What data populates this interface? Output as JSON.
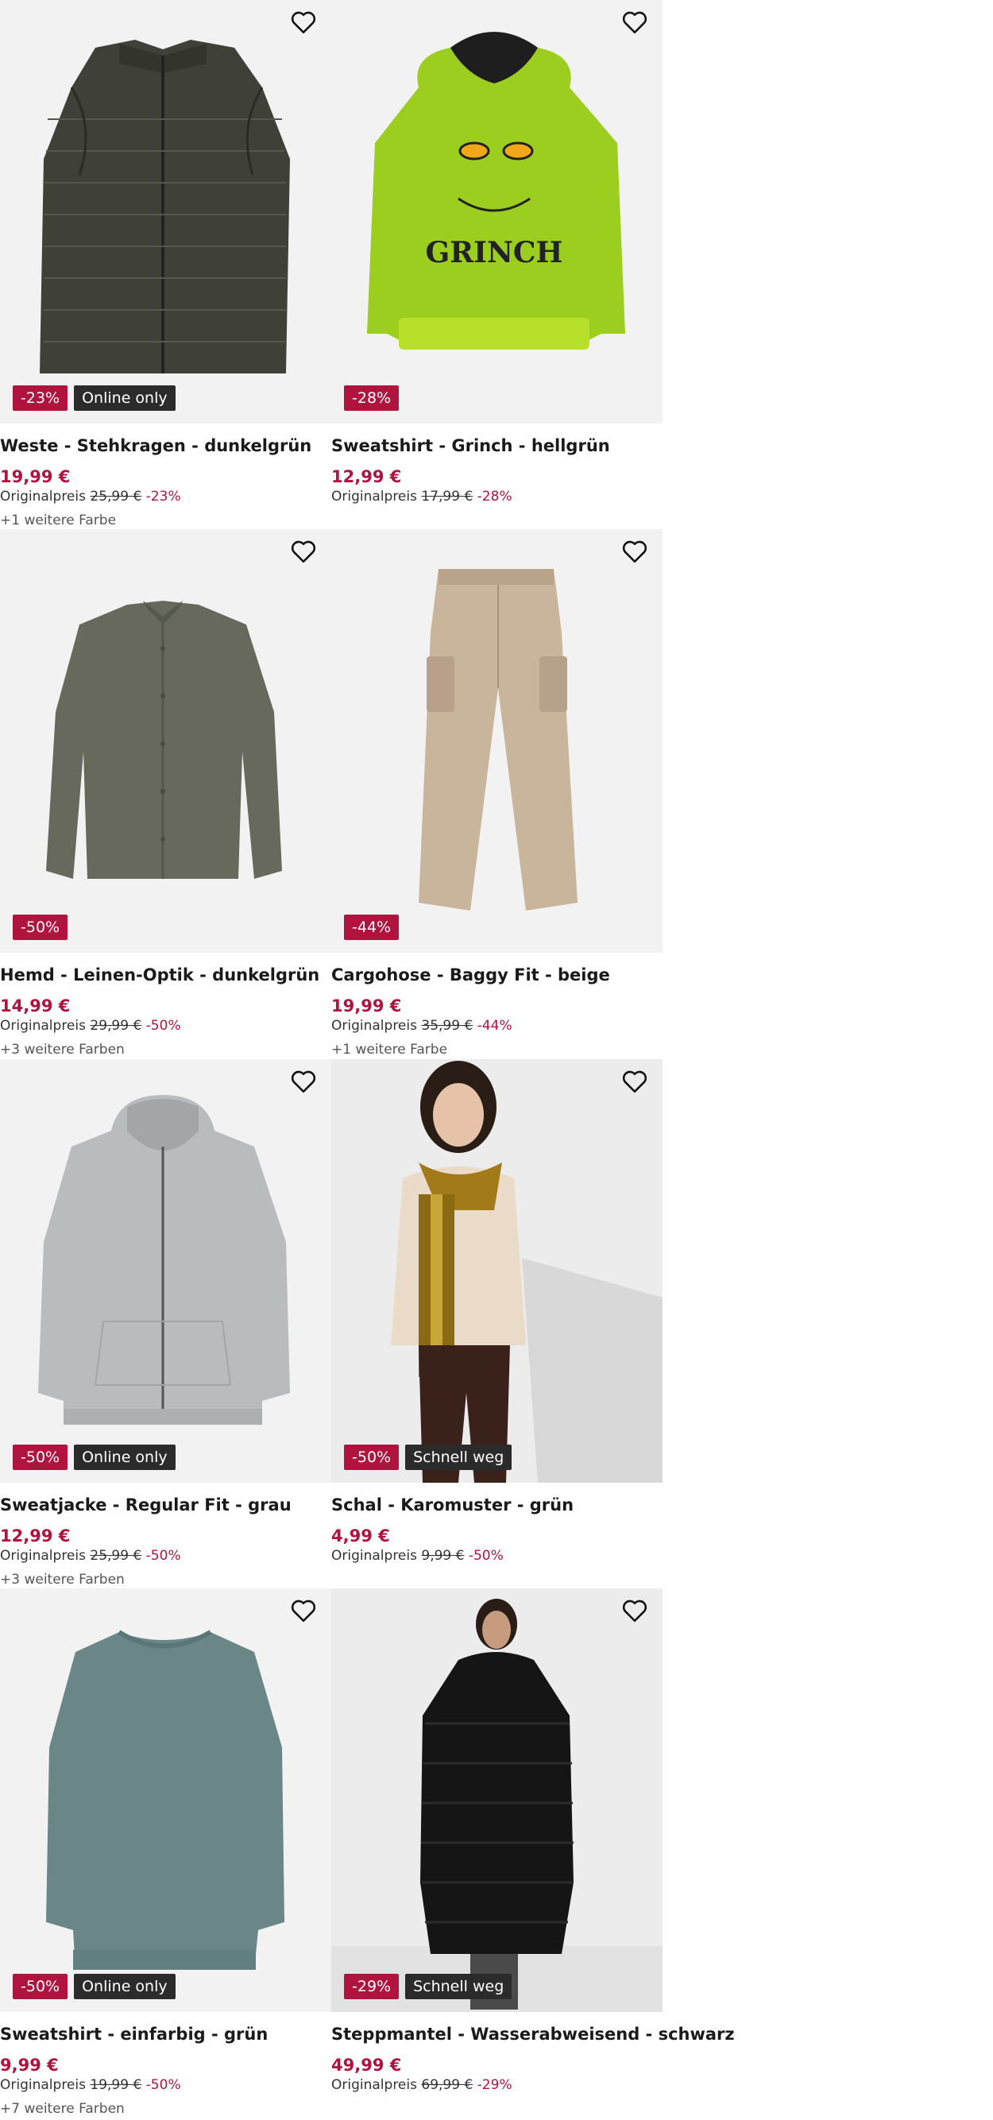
{
  "labels": {
    "original_price": "Originalpreis"
  },
  "products": [
    {
      "title": "Weste - Stehkragen - dunkelgrün",
      "price": "19,99 €",
      "old_price": "25,99 €",
      "discount": "-23%",
      "tag": "Online only",
      "more": "+1 weitere Farbe",
      "image": "vest-dark-green"
    },
    {
      "title": "Sweatshirt - Grinch - hellgrün",
      "price": "12,99 €",
      "old_price": "17,99 €",
      "discount": "-28%",
      "tag": "",
      "more": "",
      "image": "grinch-hoodie"
    },
    {
      "title": "Hemd - Leinen-Optik - dunkelgrün",
      "price": "14,99 €",
      "old_price": "29,99 €",
      "discount": "-50%",
      "tag": "",
      "more": "+3 weitere Farben",
      "image": "shirt-dark-green"
    },
    {
      "title": "Cargohose - Baggy Fit - beige",
      "price": "19,99 €",
      "old_price": "35,99 €",
      "discount": "-44%",
      "tag": "",
      "more": "+1 weitere Farbe",
      "image": "cargo-pants-beige"
    },
    {
      "title": "Sweatjacke - Regular Fit - grau",
      "price": "12,99 €",
      "old_price": "25,99 €",
      "discount": "-50%",
      "tag": "Online only",
      "more": "+3 weitere Farben",
      "image": "zip-hoodie-grey"
    },
    {
      "title": "Schal - Karomuster - grün",
      "price": "4,99 €",
      "old_price": "9,99 €",
      "discount": "-50%",
      "tag": "Schnell weg",
      "more": "",
      "image": "model-scarf"
    },
    {
      "title": "Sweatshirt - einfarbig - grün",
      "price": "9,99 €",
      "old_price": "19,99 €",
      "discount": "-50%",
      "tag": "Online only",
      "more": "+7 weitere Farben",
      "image": "sweatshirt-teal"
    },
    {
      "title": "Steppmantel - Wasserabweisend - schwarz",
      "price": "49,99 €",
      "old_price": "69,99 €",
      "discount": "-29%",
      "tag": "Schnell weg",
      "more": "",
      "image": "model-puffer-coat"
    }
  ],
  "colors": {
    "accent": "#b1133f",
    "tag_bg": "#2b2b2b",
    "image_bg": "#f2f2f2"
  },
  "icons": {
    "wishlist": "heart-outline-icon"
  }
}
